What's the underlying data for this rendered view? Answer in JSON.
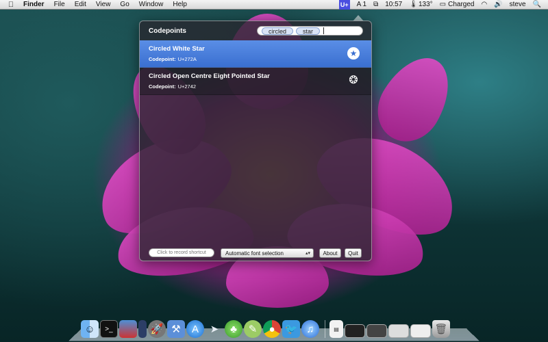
{
  "menubar": {
    "apple_icon": "apple-icon",
    "app_name": "Finder",
    "menus": [
      "File",
      "Edit",
      "View",
      "Go",
      "Window",
      "Help"
    ],
    "status": {
      "uplus": "U+",
      "input_indicator": "A 1",
      "time": "10:57",
      "temperature": "133°",
      "battery": "Charged",
      "user": "steve"
    }
  },
  "panel": {
    "title": "Codepoints",
    "search_tokens": [
      "circled",
      "star"
    ],
    "results": [
      {
        "name": "Circled White Star",
        "codepoint_label": "Codepoint:",
        "codepoint": "U+272A",
        "glyph": "★",
        "selected": true
      },
      {
        "name": "Circled Open Centre Eight Pointed Star",
        "codepoint_label": "Codepoint:",
        "codepoint": "U+2742",
        "glyph": "❂",
        "selected": false
      }
    ],
    "shortcut_placeholder": "Click to record shortcut",
    "font_selection": "Automatic font selection",
    "about_label": "About",
    "quit_label": "Quit"
  },
  "colors": {
    "selection": "#3a6fd0",
    "uplus_bg": "#4a4ee0"
  },
  "dock": {
    "icons": [
      "finder-icon",
      "terminal-icon",
      "remote-desktop-icon",
      "xcode-ruler-icon",
      "launchpad-icon",
      "xcode-icon",
      "app-store-icon",
      "send-icon",
      "adium-icon",
      "notes-icon",
      "chrome-icon",
      "twitter-icon",
      "itunes-icon",
      "document-icon",
      "window-1-icon",
      "window-2-icon",
      "window-3-icon",
      "window-4-icon",
      "trash-icon"
    ]
  }
}
